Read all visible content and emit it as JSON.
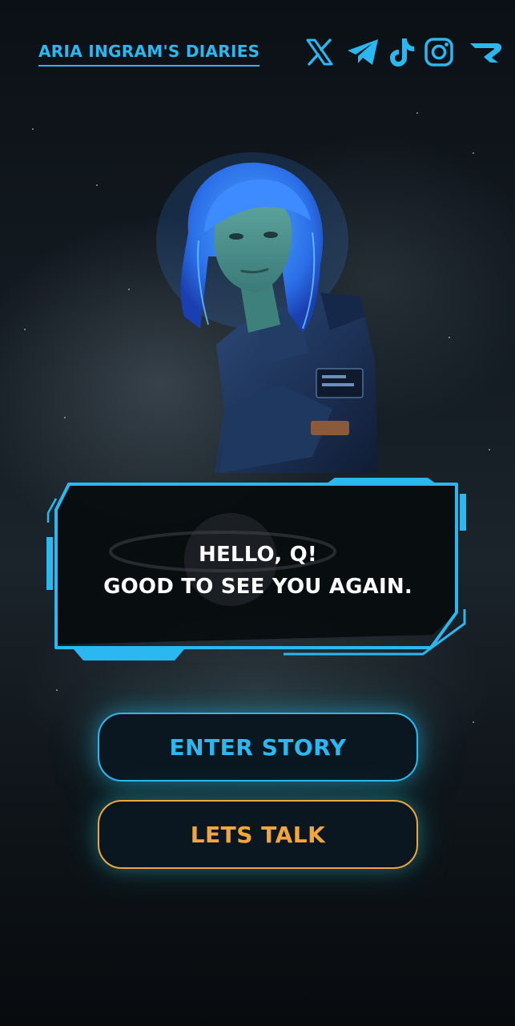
{
  "header": {
    "title": "ARIA INGRAM'S DIARIES",
    "social_icons": [
      "x-icon",
      "telegram-icon",
      "tiktok-icon",
      "instagram-icon",
      "brand-icon"
    ]
  },
  "dialog": {
    "line1": "HELLO, Q!",
    "line2": "GOOD TO SEE YOU AGAIN."
  },
  "actions": {
    "enter_story": "ENTER STORY",
    "lets_talk": "LETS TALK"
  },
  "colors": {
    "accent_blue": "#2bb8f0",
    "accent_orange": "#f2a53a",
    "background": "#0c1116"
  }
}
